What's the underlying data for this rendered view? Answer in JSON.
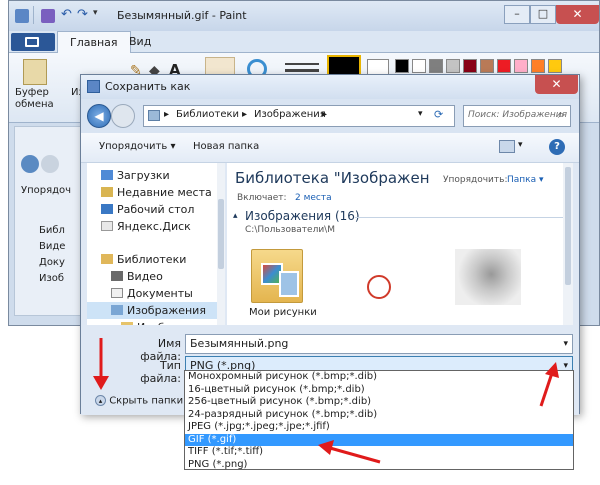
{
  "paint": {
    "title": "Безымянный.gif - Paint",
    "tab_home": "Главная",
    "tab_view": "Вид",
    "clipboard_label": "Буфер обмена",
    "image_label": "Изо",
    "ribbon_colors": [
      "#000000",
      "#ffffff",
      "#7f7f7f",
      "#c3c3c3",
      "#880015",
      "#b97a57",
      "#ed1c24",
      "#ffaec9",
      "#ff7f27",
      "#ffc90e",
      "#fff200",
      "#efe4b0",
      "#22b14c",
      "#b5e61d",
      "#00a2e8",
      "#99d9ea",
      "#3f48cc",
      "#7092be",
      "#a349a4",
      "#c8bfe7"
    ]
  },
  "bg_explorer": {
    "organize": "Упорядоч",
    "items": [
      "Библ",
      "Виде",
      "Доку",
      "Изоб"
    ]
  },
  "dialog": {
    "title": "Сохранить как",
    "breadcrumb": [
      "Библиотеки",
      "Изображения"
    ],
    "search_placeholder": "Поиск: Изображения",
    "organize": "Упорядочить",
    "new_folder": "Новая папка",
    "nav_items": [
      {
        "label": "Загрузки",
        "icon": "downloads-icon"
      },
      {
        "label": "Недавние места",
        "icon": "recent-places-icon"
      },
      {
        "label": "Рабочий стол",
        "icon": "desktop-icon"
      },
      {
        "label": "Яндекс.Диск",
        "icon": "yandex-disk-icon"
      },
      {
        "label": "Библиотеки",
        "icon": "libraries-icon"
      },
      {
        "label": "Видео",
        "icon": "video-library-icon"
      },
      {
        "label": "Документы",
        "icon": "documents-library-icon"
      },
      {
        "label": "Изображения",
        "icon": "pictures-library-icon"
      },
      {
        "label": "Изображения",
        "icon": "pictures-folder-icon"
      }
    ],
    "library_title": "Библиотека \"Изображен",
    "includes_label": "Включает:",
    "includes_link": "2 места",
    "arrange_label": "Упорядочить:",
    "arrange_value": "Папка",
    "group_header": "Изображения (16)",
    "group_path": "C:\\Пользователи\\М",
    "thumbnails": [
      {
        "label": "Мои рисунки"
      },
      {
        "label": ""
      },
      {
        "label": ""
      }
    ],
    "file_name_label": "Имя файла:",
    "file_name_value": "Безымянный.png",
    "file_type_label": "Тип файла:",
    "file_type_value": "PNG (*.png)",
    "hide_folders": "Скрыть папки",
    "file_types": [
      "Монохромный рисунок (*.bmp;*.dib)",
      "16-цветный рисунок (*.bmp;*.dib)",
      "256-цветный рисунок (*.bmp;*.dib)",
      "24-разрядный рисунок (*.bmp;*.dib)",
      "JPEG (*.jpg;*.jpeg;*.jpe;*.jfif)",
      "GIF (*.gif)",
      "TIFF (*.tif;*.tiff)",
      "PNG (*.png)"
    ],
    "selected_type": "GIF (*.gif)"
  },
  "colors": {
    "accent_red": "#e01b1b",
    "selection_blue": "#3399ff"
  }
}
